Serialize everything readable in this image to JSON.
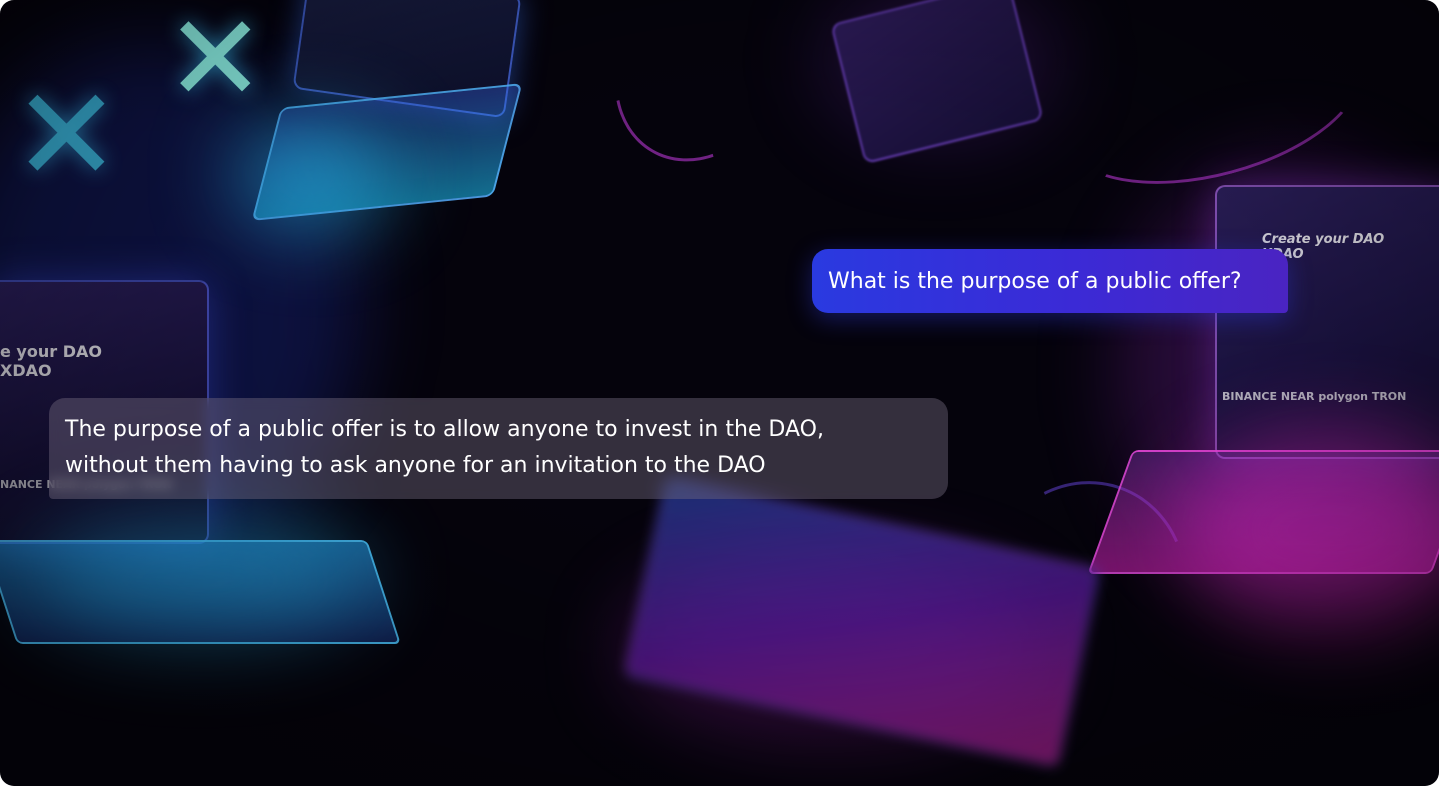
{
  "conversation": {
    "question": "What is the purpose of a public offer?",
    "answer_line1": "The purpose of a public offer is to allow anyone to invest in the DAO,",
    "answer_line2": "without them having to ask anyone for an invitation to the DAO"
  },
  "background": {
    "screen_left_title": "e your DAO",
    "screen_left_subtitle": "XDAO",
    "screen_right_title": "Create your DAO",
    "screen_right_subtitle": "XDAO",
    "partners_right": "BINANCE  NEAR  polygon  TRON",
    "partners_left": "NANCE  NEAR  polygon  TRON",
    "logo_icon": "xdao-logo-icon",
    "colors": {
      "question_bubble": "#3434dc",
      "answer_bubble": "#786e82",
      "glow_cyan": "#28c8ff",
      "glow_magenta": "#f028d2"
    }
  }
}
